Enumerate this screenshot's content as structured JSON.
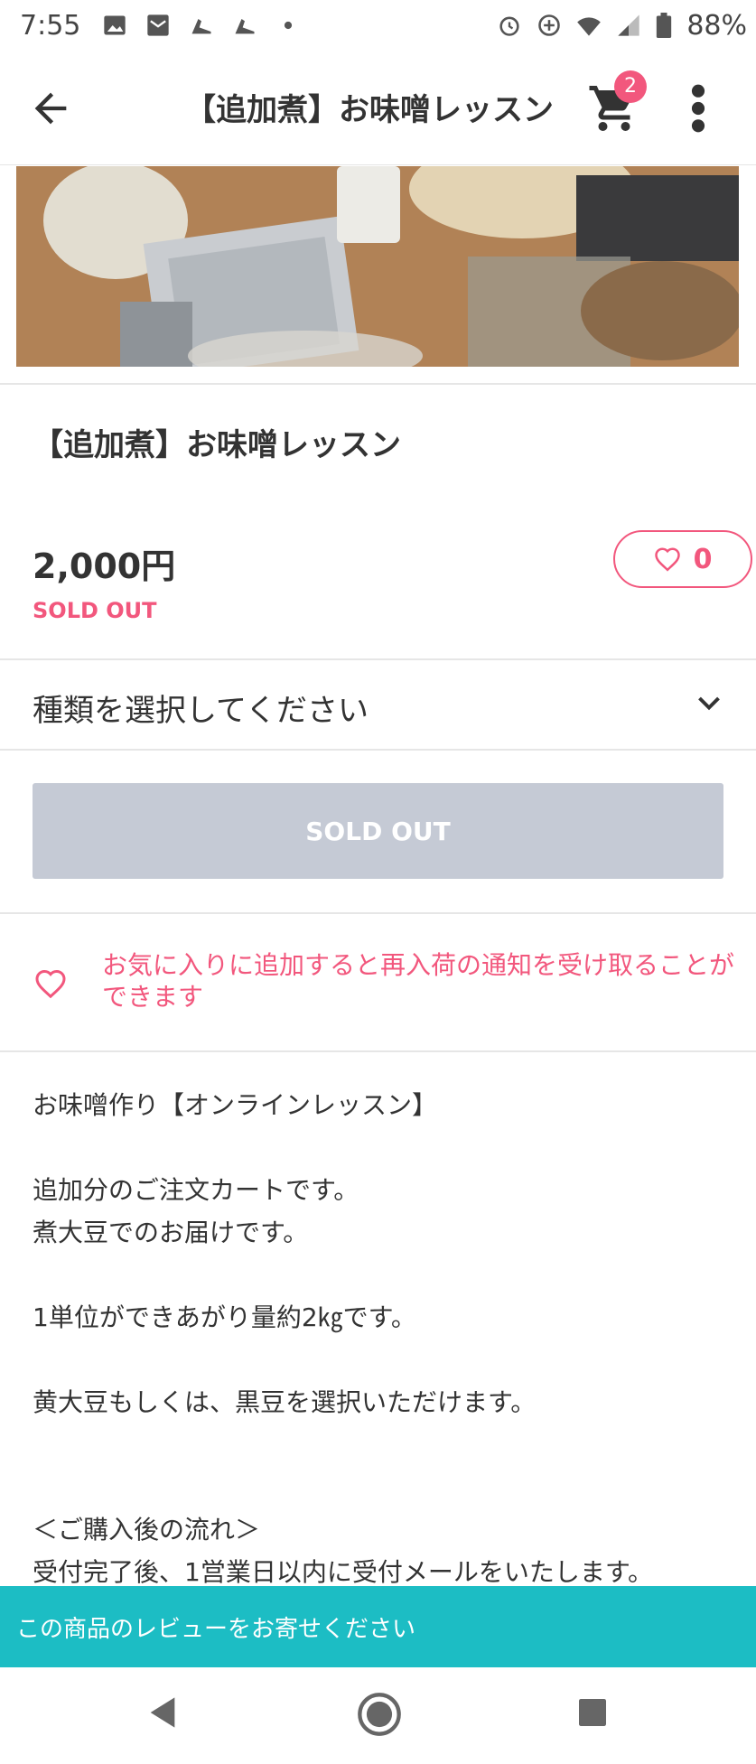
{
  "status_bar": {
    "time": "7:55",
    "battery": "88%"
  },
  "header": {
    "title": "【追加煮】お味噌レッスン",
    "cart_count": "2"
  },
  "product": {
    "title": "【追加煮】お味噌レッスン",
    "price": "2,000円",
    "status": "SOLD OUT",
    "favorite_count": "0"
  },
  "variant": {
    "placeholder": "種類を選択してください"
  },
  "purchase_button": {
    "label": "SOLD OUT"
  },
  "favorite_notice": {
    "text": "お気に入りに追加すると再入荷の通知を受け取ることができます"
  },
  "description": {
    "lines": [
      "お味噌作り【オンラインレッスン】",
      "",
      "追加分のご注文カートです。",
      "煮大豆でのお届けです。",
      "",
      "1単位ができあがり量約2㎏です。",
      "",
      "黄大豆もしくは、黒豆を選択いただけます。",
      "",
      "",
      "＜ご購入後の流れ＞",
      "受付完了後、1営業日以内に受付メールをいたします。"
    ]
  },
  "review_bar": {
    "text": "この商品のレビューをお寄せください"
  },
  "colors": {
    "accent": "#f2577d",
    "teal": "#1cbdc4",
    "disabled": "#c5cad5"
  },
  "icons": [
    "back-arrow-icon",
    "cart-icon",
    "more-vert-icon",
    "heart-icon",
    "chevron-down-icon"
  ]
}
